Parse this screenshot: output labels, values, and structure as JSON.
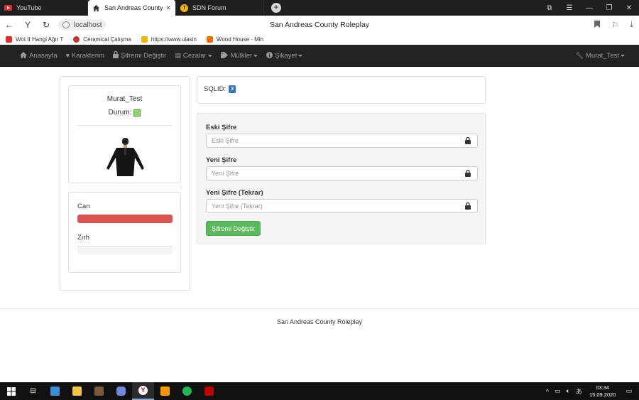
{
  "browser": {
    "tabs": [
      {
        "title": "YouTube",
        "active": false,
        "icon": "youtube-icon"
      },
      {
        "title": "San Andreas County Rol",
        "active": true,
        "icon": "home-icon"
      },
      {
        "title": "SDN Forum",
        "active": false,
        "icon": "sdn-icon"
      }
    ],
    "url": "localhost",
    "page_title": "San Andreas County Roleplay",
    "bookmarks": [
      {
        "label": "Wot II Hangi Ağır T",
        "color": "#e52d27"
      },
      {
        "label": "Ceramical Çalışma",
        "color": "#c0392b"
      },
      {
        "label": "https://www.ulasin",
        "color": "#f6b600"
      },
      {
        "label": "Wood House - Min",
        "color": "#ff6a00"
      }
    ]
  },
  "navbar": {
    "items": [
      {
        "label": "Anasayfa",
        "icon": "home-icon",
        "dropdown": false
      },
      {
        "label": "Karakterim",
        "icon": "heart-icon",
        "dropdown": false
      },
      {
        "label": "Şifremi Değiştir",
        "icon": "lock-icon",
        "dropdown": false
      },
      {
        "label": "Cezalar",
        "icon": "list-icon",
        "dropdown": true
      },
      {
        "label": "Mülkler",
        "icon": "tags-icon",
        "dropdown": true
      },
      {
        "label": "Şikayet",
        "icon": "info-icon",
        "dropdown": true
      }
    ],
    "user": {
      "label": "Murat_Test",
      "icon": "wrench-icon"
    }
  },
  "profile": {
    "name": "Murat_Test",
    "status_label": "Durum:",
    "status_color": "#8fd16b"
  },
  "stats": {
    "health": {
      "label": "Can",
      "value": 1.0,
      "color": "#d9534f"
    },
    "armor": {
      "label": "Zırh",
      "value": 0.0,
      "color": "#337ab7"
    }
  },
  "sqlid": {
    "label": "SQLID:",
    "value": "3"
  },
  "password_form": {
    "old": {
      "label": "Eski Şifre",
      "placeholder": "Eski Şifre"
    },
    "new": {
      "label": "Yeni Şifre",
      "placeholder": "Yeni Şifre"
    },
    "repeat": {
      "label": "Yeni Şifre (Tekrar)",
      "placeholder": "Yeni Şifre (Tekrar)"
    },
    "submit_label": "Şifremi Değiştir",
    "submit_color": "#5cb85c"
  },
  "footer": {
    "text": "San Andreas County Roleplay"
  },
  "taskbar": {
    "time": "03:34",
    "date": "15.09.2020"
  }
}
